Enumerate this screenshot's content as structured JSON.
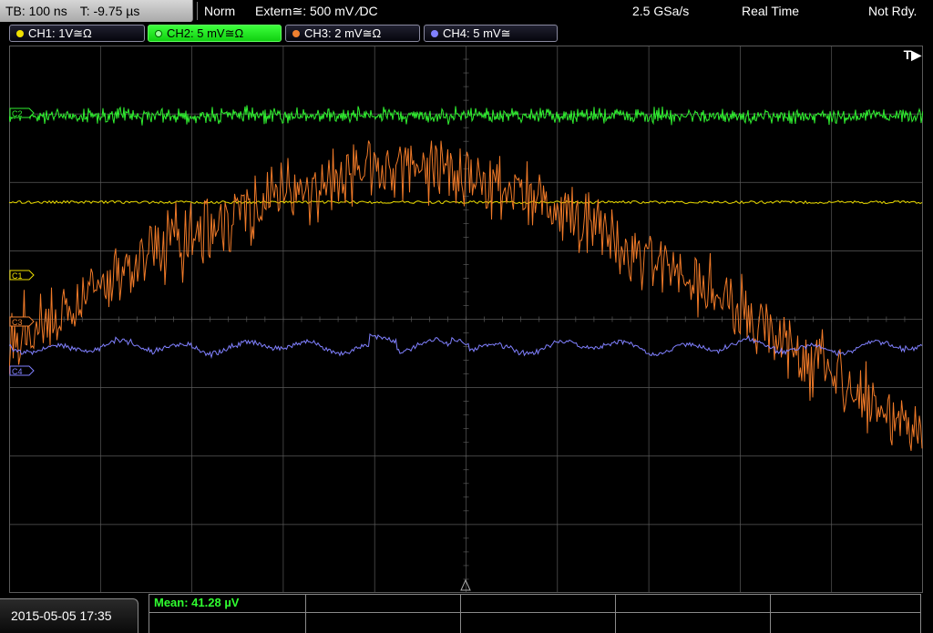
{
  "topbar": {
    "timebase": "TB: 100 ns",
    "trigger_time": "T: -9.75 µs",
    "trigger_mode": "Norm",
    "trigger_source": "Extern≅: 500 mV ⁄DC",
    "sample_rate": "2.5 GSa/s",
    "acq_mode": "Real Time",
    "status": "Not Rdy."
  },
  "channels": [
    {
      "label": "CH1: 1V≅Ω",
      "color": "#f0e000"
    },
    {
      "label": "CH2: 5 mV≅Ω",
      "color": "#30f030"
    },
    {
      "label": "CH3: 2 mV≅Ω",
      "color": "#f08030"
    },
    {
      "label": "CH4: 5 mV≅",
      "color": "#8080ff"
    }
  ],
  "markers": {
    "c1": "C1",
    "c2": "C2",
    "c3": "C3",
    "c4": "C4",
    "trigger_indicator": "T▶"
  },
  "bottom": {
    "datetime": "2015-05-05 17:35",
    "measurement": "Mean: 41.28 µV"
  },
  "colors": {
    "ch1": "#f0e000",
    "ch2": "#30f030",
    "ch3": "#f08030",
    "ch4": "#8080ff",
    "grid": "#5a5a5a",
    "background": "#000000"
  }
}
